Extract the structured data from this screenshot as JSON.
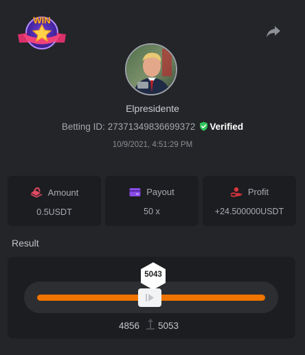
{
  "header": {
    "badge_text": "WIN",
    "share_icon": "share-arrow-icon"
  },
  "profile": {
    "username": "Elpresidente",
    "betting_id_label": "Betting ID:",
    "betting_id": "27371349836699372",
    "verified_label": "Verified",
    "timestamp": "10/9/2021, 4:51:29 PM"
  },
  "cards": [
    {
      "label": "Amount",
      "value": "0.5USDT",
      "icon": "amount-icon",
      "icon_color": "#e04a62"
    },
    {
      "label": "Payout",
      "value": "50 x",
      "icon": "card-icon",
      "icon_color": "#8b4be6"
    },
    {
      "label": "Profit",
      "value": "+24.500000USDT",
      "icon": "profit-icon",
      "icon_color": "#d9363f"
    }
  ],
  "result": {
    "label": "Result",
    "value": "5043",
    "range_min": "4856",
    "range_max": "5053"
  },
  "colors": {
    "background": "#242528",
    "panel": "#1c1d20",
    "accent": "#f07400",
    "verified": "#2fc35a"
  }
}
